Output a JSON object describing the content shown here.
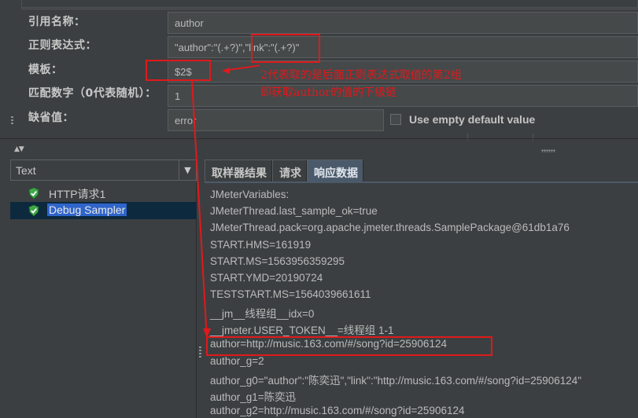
{
  "form": {
    "ref_name": {
      "label": "引用名称：",
      "value": "author"
    },
    "regex": {
      "label": "正则表达式：",
      "value": "\"author\":\"(.+?)\",\"link\":\"(.+?)\""
    },
    "template": {
      "label": "模板：",
      "value": "$2$"
    },
    "match_no": {
      "label": "匹配数字（0代表随机）：",
      "value": "1"
    },
    "default": {
      "label": "缺省值：",
      "value": "error"
    },
    "use_empty_default": {
      "label": "Use empty default value",
      "checked": false
    }
  },
  "annotation": {
    "line1": "2代表取的是后面正则表达式取值的第2组",
    "line2": "即获取author的值的下级链"
  },
  "results_panel": {
    "renderer": {
      "selected": "Text",
      "arrow": "▼"
    },
    "splitter_arrows": "▲▼",
    "tree": [
      {
        "label": "HTTP请求1",
        "status": "success"
      },
      {
        "label": "Debug Sampler",
        "status": "success",
        "selected": true
      }
    ],
    "tabs": [
      {
        "label": "取样器结果",
        "active": false
      },
      {
        "label": "请求",
        "active": false
      },
      {
        "label": "响应数据",
        "active": true
      }
    ],
    "response_lines": [
      "JMeterVariables:",
      "JMeterThread.last_sample_ok=true",
      "JMeterThread.pack=org.apache.jmeter.threads.SamplePackage@61db1a76",
      "START.HMS=161919",
      "START.MS=1563956359295",
      "START.YMD=20190724",
      "TESTSTART.MS=1564039661611",
      "__jm__线程组__idx=0",
      "__jmeter.USER_TOKEN__=线程组 1-1",
      "author=http://music.163.com/#/song?id=25906124",
      "author_g=2",
      "author_g0=\"author\":\"陈奕迅\",\"link\":\"http://music.163.com/#/song?id=25906124\"",
      "author_g1=陈奕迅",
      "author_g2=http://music.163.com/#/song?id=25906124"
    ]
  },
  "colors": {
    "background": "#3c3f41",
    "field": "#45494a",
    "annotation_red": "#e0191b",
    "selection": "#2f65ca",
    "active_tab": "#4b5a6a",
    "success_icon": "#3fa84a"
  }
}
